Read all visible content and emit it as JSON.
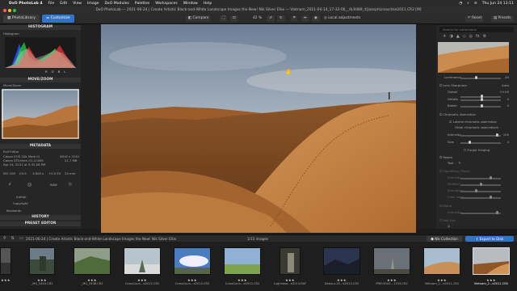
{
  "menubar": {
    "app_name": "DxO PhotoLab 4",
    "items": [
      "File",
      "Edit",
      "View",
      "Image",
      "DxO Modules",
      "Palettes",
      "Workspaces",
      "Window",
      "Help"
    ],
    "clock": "Thu Jun 24 13:11"
  },
  "window": {
    "title": "DxO PhotoLab — 2021-06-24 | Create Artistic Black-and-White Landscape Images the New! Nik Silver Efex — Vietnam_2011-04-14_17-32-06__AL9489_©JosephLinaschke2011.CR2 [M]"
  },
  "toolbar": {
    "tab_library": "PhotoLibrary",
    "tab_customize": "Customize",
    "compare_label": "Compare",
    "zoom_value": "42 %",
    "local_adjustments_label": "Local adjustments",
    "reset_label": "Reset",
    "presets_label": "Presets"
  },
  "left_panel": {
    "histogram_header": "HISTOGRAM",
    "histogram_label": "Histogram",
    "histogram_channels": [
      "R",
      "G",
      "B",
      "L"
    ],
    "movezoom_header": "MOVE/ZOOM",
    "movezoom_label": "Move/Zoom",
    "metadata_header": "METADATA",
    "exif_label": "Exif Editor",
    "camera": "Canon EOS 1Ds Mark III",
    "lens": "Canon EF24mm f/1.4 USM",
    "date": "Apr 14, 2011 at 5:32:06 PM",
    "dimensions": "5616 x 3744",
    "filesize": "21.7 MB",
    "iso": "ISO 100",
    "aperture": "f/4.5",
    "shutter": "1/400 s",
    "exposure": "+0.0 EV",
    "focal": "24 mm",
    "author_label": "Author",
    "copyright_label": "Copyright",
    "keywords_label": "Keywords",
    "history_header": "HISTORY",
    "preset_editor_header": "PRESET EDITOR"
  },
  "right_panel": {
    "search_placeholder": "Search for corrections",
    "luminance_label": "Luminance",
    "luminance_value": "40",
    "lens_sharpness_label": "Lens Sharpness",
    "lens_sharpness_mode": "Auto",
    "global_label": "Global",
    "global_value": "+0.00",
    "details_label": "Details",
    "details_value": "0",
    "bokeh_label": "Bokeh",
    "bokeh_value": "0",
    "chromatic_aberration_label": "Chromatic Aberration",
    "lateral_label": "Lateral chromatic aberration",
    "other_label": "Other chromatic aberrations",
    "intensity_label": "Intensity",
    "intensity_value": "100",
    "size_label": "Size",
    "size_value": "4",
    "purple_fringing_label": "Purple fringing",
    "repair_label": "Repair",
    "tool_label": "Tool",
    "vignetting_label": "Vignetting (Mask)",
    "intensity2_label": "Intensity",
    "midfield_label": "Midfield",
    "roundness_label": "Roundness",
    "clear_label": "Clear zone",
    "blend_label": "Blend",
    "intensity3_label": "Intensity",
    "red_eye_label": "Red Eye"
  },
  "bottom": {
    "project_path": "2021-06-24 | Create Artistic Black-and-White Landscape Images the New! Nik Silver Efex",
    "image_count": "1/15 images",
    "nik_label": "Nik Collection",
    "export_label": "Export to Disk"
  },
  "filmstrip": [
    {
      "name": "…",
      "stars": "★★★"
    },
    {
      "name": "_MG_5443.CR2",
      "stars": "★★★"
    },
    {
      "name": "_MG_5438.CR2",
      "stars": "★★★"
    },
    {
      "name": "CrossCoun…e2012.CR2",
      "stars": "★★★"
    },
    {
      "name": "CrossCoun…e2013.CR2",
      "stars": "★★★"
    },
    {
      "name": "CrossCoun…e2013.CR2",
      "stars": "★★★"
    },
    {
      "name": "Lughnasa…e2013.RAF",
      "stars": "★★★"
    },
    {
      "name": "Dasacu-20…e2013.CR2",
      "stars": "★★★"
    },
    {
      "name": "PREVIOUS…1253.CR2",
      "stars": "★★★"
    },
    {
      "name": "Vietnam_2…e2011.CR2",
      "stars": "★★★"
    },
    {
      "name": "Vietnam_2…e2011.CR2",
      "stars": "★★★"
    }
  ],
  "colors": {
    "accent": "#2f74c9",
    "panel": "#262626",
    "header": "#333333"
  }
}
